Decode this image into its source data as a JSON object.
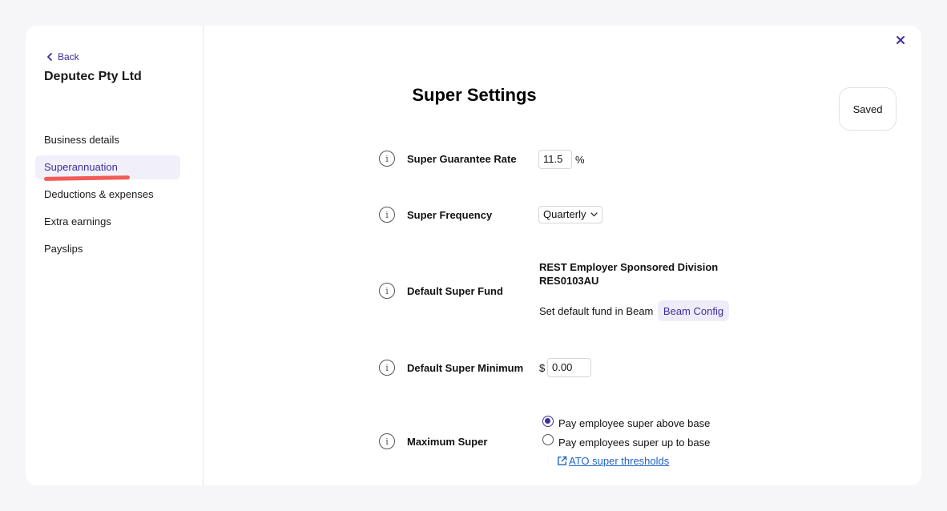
{
  "sidebar": {
    "back_label": "Back",
    "company_name": "Deputec Pty Ltd",
    "items": [
      {
        "label": "Business details",
        "active": false
      },
      {
        "label": "Superannuation",
        "active": true
      },
      {
        "label": "Deductions & expenses",
        "active": false
      },
      {
        "label": "Extra earnings",
        "active": false
      },
      {
        "label": "Payslips",
        "active": false
      }
    ]
  },
  "header": {
    "title": "Super Settings",
    "status": "Saved"
  },
  "settings": {
    "guarantee_rate": {
      "label": "Super Guarantee Rate",
      "value": "11.5",
      "suffix": "%"
    },
    "frequency": {
      "label": "Super Frequency",
      "value": "Quarterly"
    },
    "default_fund": {
      "label": "Default Super Fund",
      "fund_name": "REST Employer Sponsored Division",
      "fund_code": "RES0103AU",
      "hint": "Set default fund in Beam",
      "button_label": "Beam Config"
    },
    "default_minimum": {
      "label": "Default Super Minimum",
      "prefix": "$",
      "value": "0.00"
    },
    "maximum_super": {
      "label": "Maximum Super",
      "options": [
        {
          "label": "Pay employee super above base",
          "checked": true
        },
        {
          "label": "Pay employees super up to base",
          "checked": false
        }
      ],
      "link_label": "ATO super thresholds"
    }
  },
  "colors": {
    "accent": "#3b2f9e",
    "highlight": "#f25b57",
    "link": "#1f63c6"
  }
}
